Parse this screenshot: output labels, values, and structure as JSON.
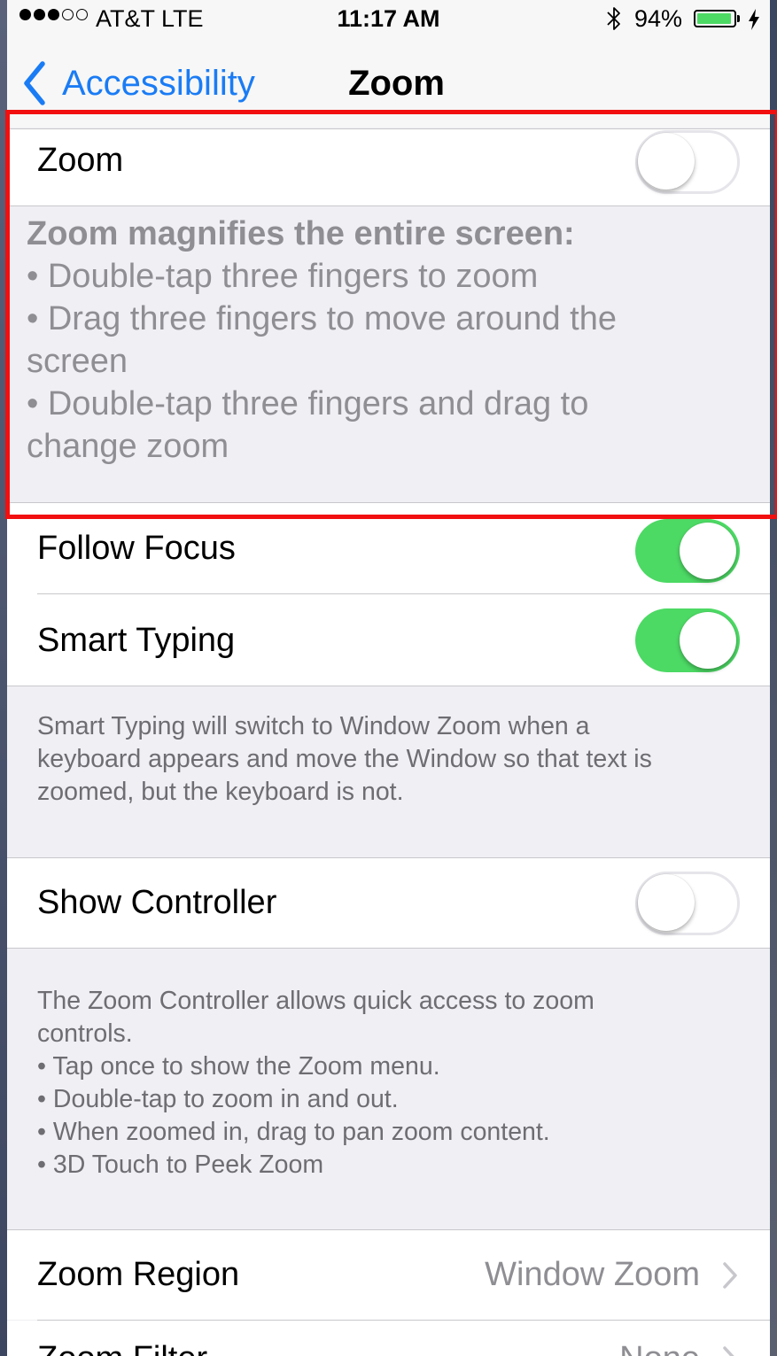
{
  "status_bar": {
    "carrier": "AT&T  LTE",
    "time": "11:17 AM",
    "battery_percent": "94%",
    "battery_level": 0.94,
    "signal_bars": 3,
    "signal_total": 5
  },
  "nav": {
    "back_label": "Accessibility",
    "title": "Zoom"
  },
  "zoom_row": {
    "label": "Zoom",
    "enabled": false
  },
  "zoom_description": {
    "heading": "Zoom magnifies the entire screen:",
    "line1": "•  Double-tap three fingers to zoom",
    "line2": "•  Drag three fingers to move around the",
    "line3": "screen",
    "line4": "•  Double-tap three fingers and drag to",
    "line5": "change zoom"
  },
  "follow_focus": {
    "label": "Follow Focus",
    "enabled": true
  },
  "smart_typing": {
    "label": "Smart Typing",
    "enabled": true
  },
  "smart_typing_footer": {
    "line1": "Smart Typing will switch to Window Zoom when a",
    "line2": "keyboard appears and move the Window so that text is",
    "line3": "zoomed, but the keyboard is not."
  },
  "show_controller": {
    "label": "Show Controller",
    "enabled": false
  },
  "controller_footer": {
    "line1": "The Zoom Controller allows quick access to zoom",
    "line2": "controls.",
    "line3": "• Tap once to show the Zoom menu.",
    "line4": "• Double-tap to zoom in and out.",
    "line5": "• When zoomed in, drag to pan zoom content.",
    "line6": "• 3D Touch to Peek Zoom"
  },
  "zoom_region": {
    "label": "Zoom Region",
    "value": "Window Zoom"
  },
  "zoom_filter": {
    "label": "Zoom Filter",
    "value": "None"
  },
  "colors": {
    "accent": "#1a7cf5",
    "toggle_on": "#4cd964",
    "highlight": "#f20f0f",
    "background": "#efeff4"
  }
}
